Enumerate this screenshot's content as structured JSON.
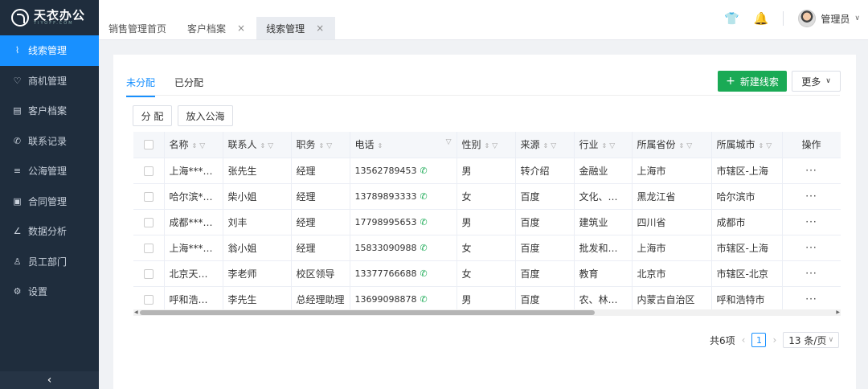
{
  "app": {
    "logo_text": "天衣办公",
    "logo_sub": "TIYOFF.COM"
  },
  "sidebar": {
    "items": [
      {
        "label": "线索管理",
        "icon": "lead-icon",
        "glyph": "⌇"
      },
      {
        "label": "商机管理",
        "icon": "bulb-icon",
        "glyph": "♡"
      },
      {
        "label": "客户档案",
        "icon": "file-icon",
        "glyph": "▤"
      },
      {
        "label": "联系记录",
        "icon": "phone-icon",
        "glyph": "✆"
      },
      {
        "label": "公海管理",
        "icon": "list-icon",
        "glyph": "≡"
      },
      {
        "label": "合同管理",
        "icon": "contract-icon",
        "glyph": "▣"
      },
      {
        "label": "数据分析",
        "icon": "chart-icon",
        "glyph": "∠"
      },
      {
        "label": "员工部门",
        "icon": "user-icon",
        "glyph": "♙"
      },
      {
        "label": "设置",
        "icon": "gear-icon",
        "glyph": "⚙"
      }
    ],
    "collapse_glyph": "‹"
  },
  "header": {
    "tabs": [
      {
        "label": "销售管理首页",
        "closable": false
      },
      {
        "label": "客户档案",
        "closable": true
      },
      {
        "label": "线索管理",
        "closable": true
      }
    ],
    "close_glyph": "×",
    "shirt_glyph": "👕",
    "bell_glyph": "🔔",
    "user_name": "管理员",
    "caret": "∨"
  },
  "main": {
    "subtabs": [
      "未分配",
      "已分配"
    ],
    "new_button": "新建线索",
    "new_glyph": "+",
    "more_button": "更多",
    "more_caret": "∨",
    "assign_button": "分 配",
    "pool_button": "放入公海"
  },
  "table": {
    "columns": [
      "名称",
      "联系人",
      "职务",
      "电话",
      "性别",
      "来源",
      "行业",
      "所属省份",
      "所属城市",
      "操作"
    ],
    "sort_glyph": "⇕",
    "filter_glyph": "▽",
    "phone_glyph": "✆",
    "rows": [
      {
        "name": "上海****有...",
        "contact": "张先生",
        "title": "经理",
        "phone": "13562789453",
        "gender": "男",
        "source": "转介绍",
        "industry": "金融业",
        "province": "上海市",
        "city": "市辖区-上海",
        "ops": "···"
      },
      {
        "name": "哈尔滨****...",
        "contact": "柴小姐",
        "title": "经理",
        "phone": "13789893333",
        "gender": "女",
        "source": "百度",
        "industry": "文化、体...",
        "province": "黑龙江省",
        "city": "哈尔滨市",
        "ops": "···"
      },
      {
        "name": "成都*****...",
        "contact": "刘丰",
        "title": "经理",
        "phone": "17798995653",
        "gender": "男",
        "source": "百度",
        "industry": "建筑业",
        "province": "四川省",
        "city": "成都市",
        "ops": "···"
      },
      {
        "name": "上海******...",
        "contact": "翁小姐",
        "title": "经理",
        "phone": "15833090988",
        "gender": "女",
        "source": "百度",
        "industry": "批发和零...",
        "province": "上海市",
        "city": "市辖区-上海",
        "ops": "···"
      },
      {
        "name": "北京天天*...",
        "contact": "李老师",
        "title": "校区领导",
        "phone": "13377766688",
        "gender": "女",
        "source": "百度",
        "industry": "教育",
        "province": "北京市",
        "city": "市辖区-北京",
        "ops": "···"
      },
      {
        "name": "呼和浩特*...",
        "contact": "李先生",
        "title": "总经理助理",
        "phone": "13699098878",
        "gender": "男",
        "source": "百度",
        "industry": "农、林、...",
        "province": "内蒙古自治区",
        "city": "呼和浩特市",
        "ops": "···"
      }
    ]
  },
  "pagination": {
    "total": "共6项",
    "current": "1",
    "page_size": "13 条/页",
    "prev": "‹",
    "next": "›",
    "caret": "∨"
  },
  "colors": {
    "primary": "#1890ff",
    "success": "#1aaa55",
    "sidebar_bg": "#1f2d3d"
  }
}
